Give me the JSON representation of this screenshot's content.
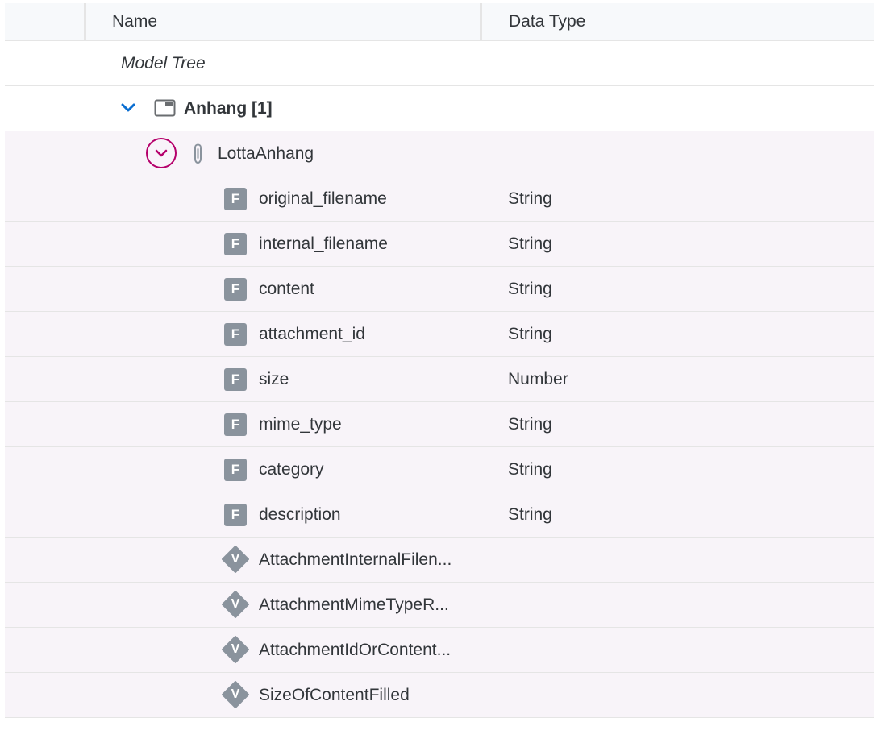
{
  "header": {
    "name_col": "Name",
    "type_col": "Data Type"
  },
  "tree": {
    "root_label": "Model Tree",
    "group": {
      "label": "Anhang [1]",
      "icon": "window-icon",
      "toggle_icon": "chevron-down-icon"
    },
    "entity": {
      "label": "LottaAnhang",
      "icon": "paperclip-icon",
      "toggle_icon": "chevron-down-circle-icon"
    },
    "fields": [
      {
        "icon_letter": "F",
        "name": "original_filename",
        "type": "String"
      },
      {
        "icon_letter": "F",
        "name": "internal_filename",
        "type": "String"
      },
      {
        "icon_letter": "F",
        "name": "content",
        "type": "String"
      },
      {
        "icon_letter": "F",
        "name": "attachment_id",
        "type": "String"
      },
      {
        "icon_letter": "F",
        "name": "size",
        "type": "Number"
      },
      {
        "icon_letter": "F",
        "name": "mime_type",
        "type": "String"
      },
      {
        "icon_letter": "F",
        "name": "category",
        "type": "String"
      },
      {
        "icon_letter": "F",
        "name": "description",
        "type": "String"
      }
    ],
    "validations": [
      {
        "icon_letter": "V",
        "name": "AttachmentInternalFilen..."
      },
      {
        "icon_letter": "V",
        "name": "AttachmentMimeTypeR..."
      },
      {
        "icon_letter": "V",
        "name": "AttachmentIdOrContent..."
      },
      {
        "icon_letter": "V",
        "name": "SizeOfContentFilled"
      }
    ]
  },
  "colors": {
    "accent": "#0a6ed1",
    "focus_ring": "#b5006b",
    "field_icon_bg": "#8a939d",
    "row_tint": "#f8f4f9"
  }
}
